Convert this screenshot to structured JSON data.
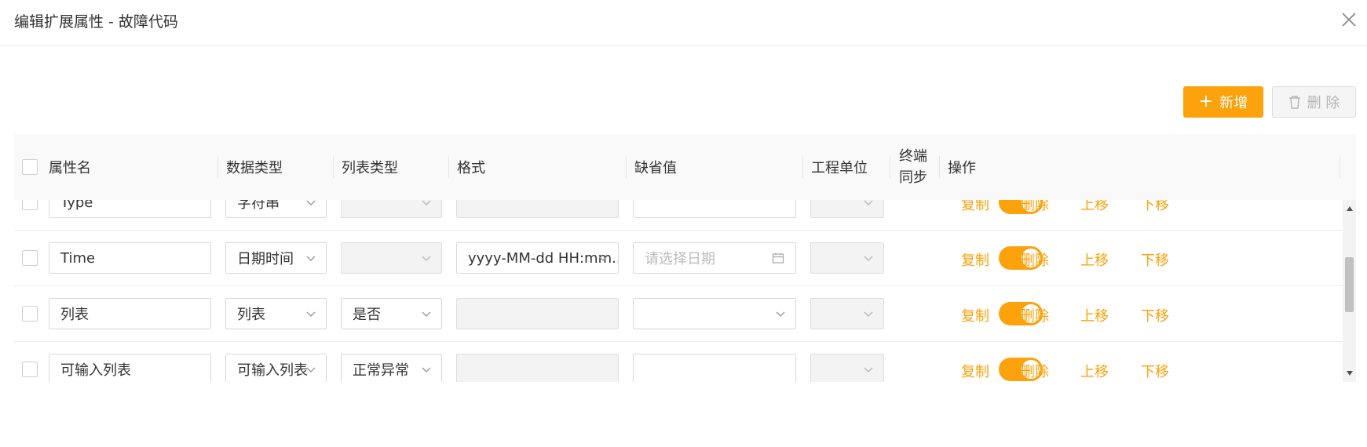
{
  "dialog": {
    "title": "编辑扩展属性 - 故障代码"
  },
  "toolbar": {
    "add_label": "新增",
    "delete_label": "删 除"
  },
  "columns": {
    "name": "属性名",
    "data_type": "数据类型",
    "list_type": "列表类型",
    "format": "格式",
    "default": "缺省值",
    "unit": "工程单位",
    "sync_line1": "终端",
    "sync_line2": "同步",
    "actions": "操作"
  },
  "rows": [
    {
      "name": "Type",
      "data_type": "字符串",
      "list_type": "",
      "format": "",
      "default": "",
      "default_placeholder": "",
      "unit": "",
      "sync": true
    },
    {
      "name": "Time",
      "data_type": "日期时间",
      "list_type": "",
      "format": "yyyy-MM-dd HH:mm...",
      "default": "",
      "default_placeholder": "请选择日期",
      "unit": "",
      "sync": true
    },
    {
      "name": "列表",
      "data_type": "列表",
      "list_type": "是否",
      "format": "",
      "default": "",
      "default_placeholder": "",
      "unit": "",
      "sync": true
    },
    {
      "name": "可输入列表",
      "data_type": "可输入列表",
      "list_type": "正常异常",
      "format": "",
      "default": "",
      "default_placeholder": "",
      "unit": "",
      "sync": true
    }
  ],
  "row_actions": {
    "copy": "复制",
    "delete": "删除",
    "move_up": "上移",
    "move_down": "下移"
  },
  "colors": {
    "accent": "#fba20c",
    "header_bg": "#f9f9f9",
    "disabled_bg": "#f3f3f3"
  }
}
